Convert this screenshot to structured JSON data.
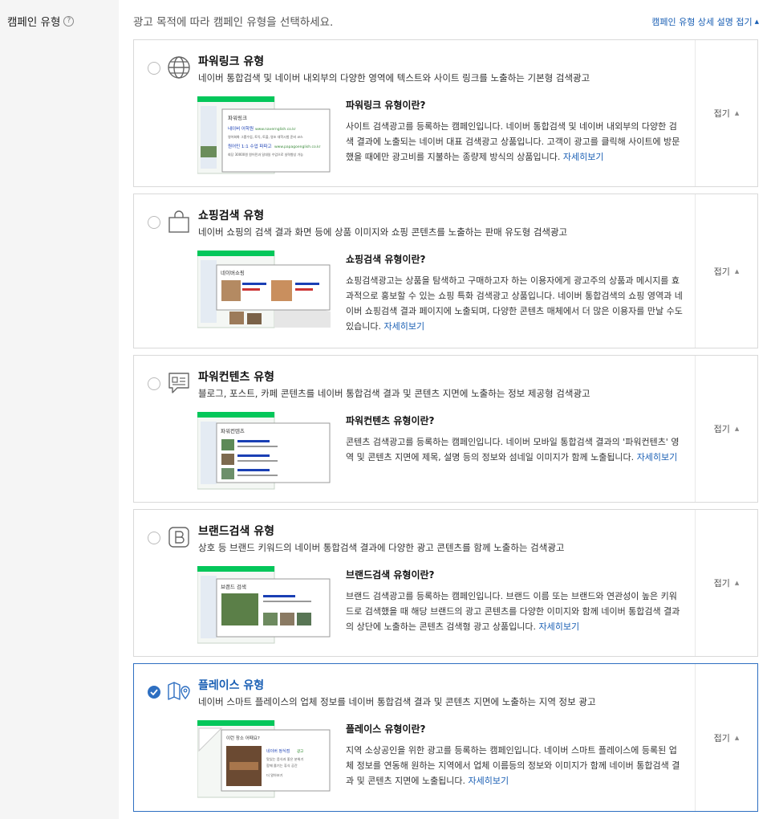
{
  "field": {
    "label": "캠페인 유형",
    "help_icon": "question-circle-icon"
  },
  "instruction": "광고 목적에 따라 캠페인 유형을 선택하세요.",
  "collapse_all": {
    "label": "캠페인 유형 상세 설명 접기",
    "icon": "caret-up"
  },
  "fold_label": "접기",
  "colors": {
    "accent": "#2e6fc1",
    "link": "#1a5fb4",
    "naver_green": "#03c75a",
    "border": "#d9d9d9"
  },
  "cards": [
    {
      "icon": "globe-icon",
      "title": "파워링크 유형",
      "desc": "네이버 통합검색 및 네이버 내외부의 다양한 영역에 텍스트와 사이트 링크를 노출하는 기본형 검색광고",
      "detail_title": "파워링크 유형이란?",
      "detail_text": "사이트 검색광고를 등록하는 캠페인입니다. 네이버 통합검색 및 네이버 내외부의 다양한 검색 결과에 노출되는 네이버 대표 검색광고 상품입니다. 고객이 광고를 클릭해 사이트에 방문했을 때에만 광고비를 지불하는 종량제 방식의 상품입니다.",
      "more": "자세히보기",
      "thumb": {
        "heading": "파워링크",
        "line1": "네이버 어학원",
        "url1": "www.navernglish.co.kr",
        "desc1": "영어회화 그룹수업, 토익, 토플, 영조 대학시험 준비 코스",
        "line2": "원어민 1:1 수업 파파고",
        "url2": "www.papagoenglish.co.kr",
        "desc2": "회당 30000원 원어민과 일대일 수업으로 실력향상 가능"
      },
      "selected": false
    },
    {
      "icon": "shopping-bag-icon",
      "title": "쇼핑검색 유형",
      "desc": "네이버 쇼핑의 검색 결과 화면 등에 상품 이미지와 쇼핑 콘텐츠를 노출하는 판매 유도형 검색광고",
      "detail_title": "쇼핑검색 유형이란?",
      "detail_text": "쇼핑검색광고는 상품을 탐색하고 구매하고자 하는 이용자에게 광고주의 상품과 메시지를 효과적으로 홍보할 수 있는 쇼핑 특화 검색광고 상품입니다. 네이버 통합검색의 쇼핑 영역과 네이버 쇼핑검색 결과 페이지에 노출되며, 다양한 콘텐츠 매체에서 더 많은 이용자를 만날 수도 있습니다.",
      "more": "자세히보기",
      "thumb": {
        "heading": "네이버쇼핑"
      },
      "selected": false
    },
    {
      "icon": "content-doc-icon",
      "title": "파워컨텐츠 유형",
      "desc": "블로그, 포스트, 카페 콘텐츠를 네이버 통합검색 결과 및 콘텐츠 지면에 노출하는 정보 제공형 검색광고",
      "detail_title": "파워컨텐츠 유형이란?",
      "detail_text": "콘텐츠 검색광고를 등록하는 캠페인입니다. 네이버 모바일 통합검색 결과의 '파워컨텐츠' 영역 및 콘텐츠 지면에 제목, 설명 등의 정보와 섬네일 이미지가 함께 노출됩니다.",
      "more": "자세히보기",
      "thumb": {
        "heading": "파워컨텐츠"
      },
      "selected": false
    },
    {
      "icon": "brand-b-icon",
      "title": "브랜드검색 유형",
      "desc": "상호 등 브랜드 키워드의 네이버 통합검색 결과에 다양한 광고 콘텐츠를 함께 노출하는 검색광고",
      "detail_title": "브랜드검색 유형이란?",
      "detail_text": "브랜드 검색광고를 등록하는 캠페인입니다. 브랜드 이름 또는 브랜드와 연관성이 높은 키워드로 검색했을 때 해당 브랜드의 광고 콘텐츠를 다양한 이미지와 함께 네이버 통합검색 결과의 상단에 노출하는 콘텐츠 검색형 광고 상품입니다.",
      "more": "자세히보기",
      "thumb": {
        "heading": "브랜드 검색"
      },
      "selected": false
    },
    {
      "icon": "map-pin-icon",
      "title": "플레이스 유형",
      "desc": "네이버 스마트 플레이스의 업체 정보를 네이버 통합검색 결과 및 콘텐츠 지면에 노출하는 지역 정보 광고",
      "detail_title": "플레이스 유형이란?",
      "detail_text": "지역 소상공인을 위한 광고를 등록하는 캠페인입니다. 네이버 스마트 플레이스에 등록된 업체 정보를 연동해 원하는 지역에서 업체 이름등의 정보와 이미지가 함께 네이버 통합검색 결과 및 콘텐츠 지면에 노출됩니다.",
      "more": "자세히보기",
      "thumb": {
        "heading": "이런 장소 어때요?",
        "name": "네이버 정식점",
        "badge": "광고",
        "desc1": "맛있는 음식과 좋은 분위기",
        "desc2": "함께 즐기는 휴식 공간",
        "more": "더 알아보기"
      },
      "selected": true
    }
  ]
}
